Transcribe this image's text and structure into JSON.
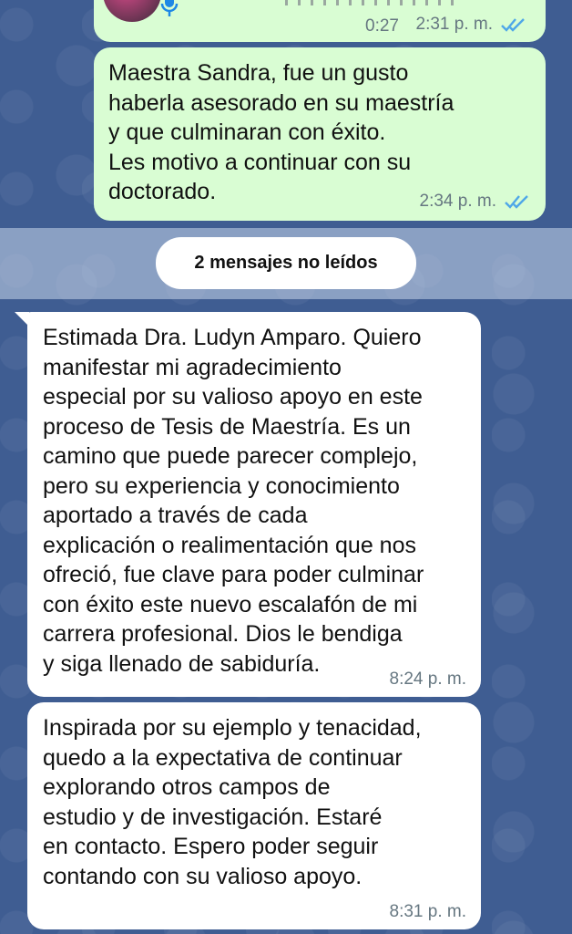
{
  "voice_message": {
    "duration": "0:27",
    "time": "2:31 p. m."
  },
  "messages": [
    {
      "direction": "outgoing",
      "text": "Maestra Sandra, fue un gusto\nhaberla asesorado en su maestría\ny que culminaran con éxito.\nLes motivo a continuar con su\ndoctorado.",
      "time": "2:34 p. m."
    },
    {
      "direction": "incoming",
      "text": "Estimada Dra. Ludyn Amparo. Quiero\nmanifestar mi agradecimiento\nespecial por su valioso apoyo en este\nproceso de Tesis de Maestría. Es un\ncamino que puede parecer complejo,\npero su experiencia y conocimiento\naportado a través de cada\nexplicación o realimentación que nos\nofreció, fue clave para poder culminar\ncon éxito este nuevo escalafón de mi\ncarrera profesional.  Dios le bendiga\ny siga llenado de sabiduría.",
      "time": "8:24 p. m."
    },
    {
      "direction": "incoming",
      "text": "Inspirada por su ejemplo y tenacidad,\nquedo a la expectativa de continuar\nexplorando otros campos de\nestudio y de investigación. Estaré\nen contacto. Espero poder seguir\ncontando con su valioso apoyo.",
      "time": "8:31 p. m."
    }
  ],
  "unread_banner": "2 mensajes no leídos",
  "colors": {
    "outgoing_bubble": "#d9fdd3",
    "incoming_bubble": "#ffffff",
    "read_ticks": "#4fa7e8",
    "wallpaper": "#3f5d92"
  },
  "icons": [
    "microphone-icon",
    "double-check-icon"
  ]
}
